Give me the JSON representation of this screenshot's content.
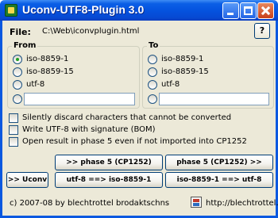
{
  "window": {
    "title": "Uconv-UTF8-Plugin 3.0"
  },
  "file": {
    "label": "File:",
    "path": "C:\\Web\\iconvplugin.html"
  },
  "help": {
    "label": "?"
  },
  "from": {
    "title": "From",
    "options": [
      "iso-8859-1",
      "iso-8859-15",
      "utf-8"
    ],
    "selected": "iso-8859-1",
    "custom_value": ""
  },
  "to": {
    "title": "To",
    "options": [
      "iso-8859-1",
      "iso-8859-15",
      "utf-8"
    ],
    "selected": "",
    "custom_value": ""
  },
  "checkboxes": [
    "Silently discard characters that cannot be converted",
    "Write UTF-8 with signature (BOM)",
    "Open result in phase 5 even if not imported into CP1252"
  ],
  "buttons": {
    "uconv": ">> Uconv",
    "to_phase5": ">> phase 5 (CP1252)",
    "from_phase5": "phase 5 (CP1252) >>",
    "utf8_to_iso": "utf-8 ==> iso-8859-1",
    "iso_to_utf8": "iso-8859-1 ==> utf-8"
  },
  "footer": {
    "copyright": "c) 2007-08 by blechtrottel brodaktschns",
    "url": "http://blechtrottel.net"
  }
}
